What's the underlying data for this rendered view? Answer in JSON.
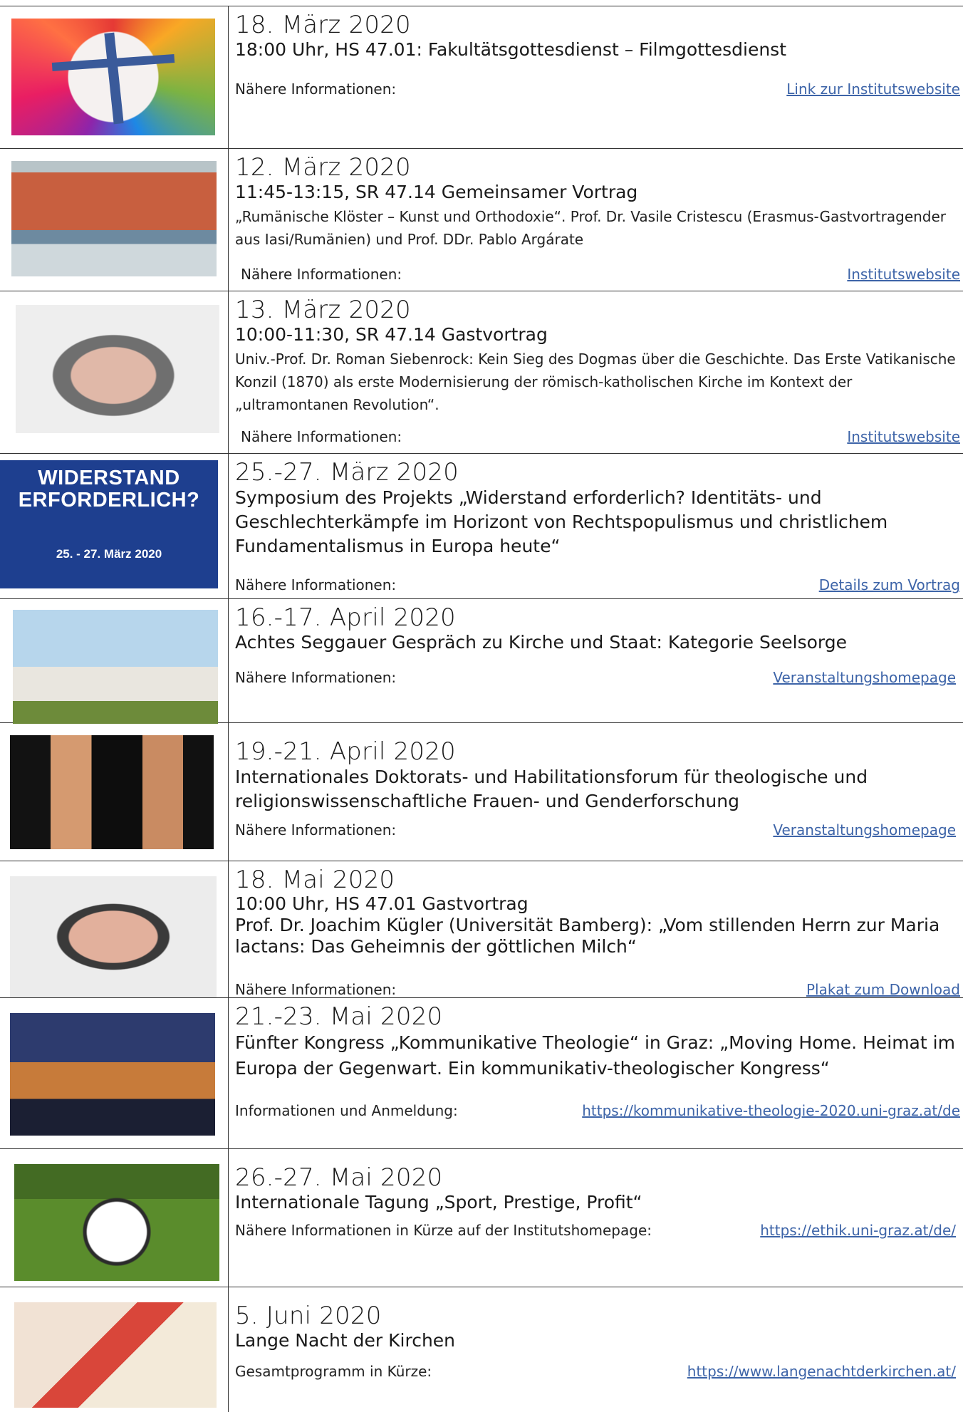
{
  "events": [
    {
      "image": "cross-painting-thumbnail",
      "date": "18. März 2020",
      "subtitle": "18:00 Uhr, HS 47.01: Fakultätsgottesdienst – Filmgottesdienst",
      "description": "",
      "info_label": "Nähere Informationen:",
      "link": "Link zur Institutswebsite"
    },
    {
      "image": "monastery-fresco-thumbnail",
      "date": "12. März 2020",
      "subtitle": "11:45-13:15, SR 47.14 Gemeinsamer Vortrag",
      "description": "„Rumänische Klöster – Kunst und Orthodoxie“. Prof. Dr. Vasile Cristescu (Erasmus-Gastvortragender aus Iasi/Rumänien) und Prof. DDr. Pablo Argárate",
      "info_label": "Nähere Informationen:",
      "link": "Institutswebsite"
    },
    {
      "image": "speaker-portrait-thumbnail",
      "date": "13. März 2020",
      "subtitle": "10:00-11:30, SR 47.14 Gastvortrag",
      "description": "Univ.-Prof. Dr. Roman Siebenrock: Kein Sieg des Dogmas über die Geschichte. Das Erste Vatikanische Konzil (1870) als erste Modernisierung der römisch-katholischen Kirche im Kontext der „ultramontanen Revolution“.",
      "info_label": "Nähere Informationen:",
      "link": "Institutswebsite"
    },
    {
      "image": "symposium-poster-thumbnail",
      "poster_title": "WIDERSTAND ERFORDERLICH?",
      "poster_date": "25. - 27. März 2020",
      "date": "25.-27. März 2020",
      "subtitle": "Symposium des Projekts „Widerstand erforderlich? Identitäts- und Geschlechterkämpfe im Horizont von Rechtspopulismus und christlichem Fundamentalismus in Europa heute“",
      "description": "",
      "info_label": "Nähere Informationen:",
      "link": "Details zum Vortrag"
    },
    {
      "image": "chapel-thumbnail",
      "date": "16.-17. April 2020",
      "subtitle": "Achtes Seggauer Gespräch zu Kirche und Staat: Kategorie Seelsorge",
      "description": "",
      "info_label": "Nähere Informationen:",
      "link": "Veranstaltungshomepage"
    },
    {
      "image": "adam-eve-painting-thumbnail",
      "date": "19.-21. April 2020",
      "subtitle": "Internationales Doktorats- und Habilitationsforum für theologische und religionswissenschaftliche Frauen- und Genderforschung",
      "description": "",
      "info_label": "Nähere Informationen:",
      "link": "Veranstaltungshomepage"
    },
    {
      "image": "speaker-portrait-thumbnail",
      "date": "18. Mai 2020",
      "subtitle": "10:00 Uhr, HS 47.01 Gastvortrag",
      "subtitle2": "Prof. Dr. Joachim Kügler (Universität Bamberg): „Vom stillenden Herrn zur Maria lactans: Das Geheimnis der göttlichen Milch“",
      "description": "",
      "info_label": "Nähere Informationen:",
      "link": "Plakat zum Download"
    },
    {
      "image": "city-network-thumbnail",
      "date": "21.-23. Mai 2020",
      "subtitle": "Fünfter Kongress „Kommunikative Theologie“ in Graz: „Moving Home. Heimat im Europa der Gegenwart. Ein kommunikativ-theologischer Kongress“",
      "description": "",
      "info_label": "Informationen und Anmeldung:",
      "link": "https://kommunikative-theologie-2020.uni-graz.at/de"
    },
    {
      "image": "football-thumbnail",
      "date": "26.-27. Mai 2020",
      "subtitle": "Internationale Tagung „Sport, Prestige, Profit“",
      "description": "",
      "info_label": "Nähere Informationen in Kürze auf der Institutshomepage:",
      "link": "https://ethik.uni-graz.at/de/"
    },
    {
      "image": "map-pins-thumbnail",
      "date": "5. Juni 2020",
      "subtitle": "Lange Nacht der Kirchen",
      "description": "",
      "info_label": "Gesamtprogramm in Kürze:",
      "link": "https://www.langenachtderkirchen.at/"
    }
  ],
  "colors": {
    "link": "#3d64a8",
    "rule": "#333333"
  }
}
